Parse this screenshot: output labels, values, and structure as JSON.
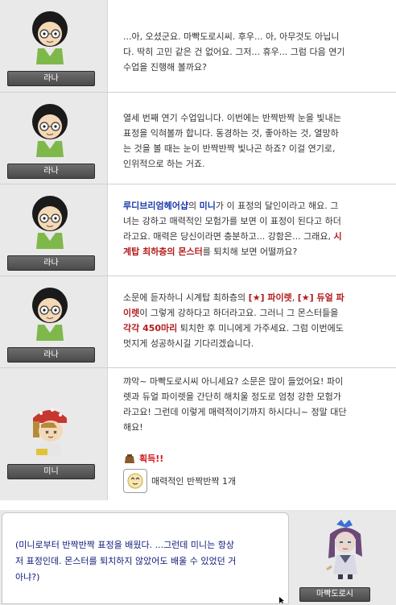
{
  "dialogs": [
    {
      "name": "라나",
      "lines": [
        "...아, 오셨군요. 마빡도로시씨. 후우... 아, 아무것도 아닙니",
        "다. 딱히 고민 같은 건 없어요. 그저... 휴우... 그럼 다음 연기",
        "수업을 진행해 볼까요?"
      ]
    },
    {
      "name": "라나",
      "lines": [
        "열세 번째 연기 수업입니다. 이번에는 반짝반짝 눈을 빛내는",
        "표정을 익혀볼까 합니다. 동경하는 것, 좋아하는 것, 열망하",
        "는 것을 볼 때는 눈이 반짝반짝 빛나곤 하죠? 이걸 연기로,",
        "인위적으로 하는 거죠."
      ]
    },
    {
      "name": "라나",
      "segments": [
        {
          "t": "루디브리엄헤어샵",
          "c": "blue"
        },
        {
          "t": "의 ",
          "c": ""
        },
        {
          "t": "미니",
          "c": "blue"
        },
        {
          "t": "가 이 표정의 달인이라고 해요. 그",
          "c": ""
        },
        {
          "t": "\n",
          "c": ""
        },
        {
          "t": "녀는 강하고 매력적인 모험가를 보면 이 표정이 된다고 하더",
          "c": ""
        },
        {
          "t": "\n",
          "c": ""
        },
        {
          "t": "라고요. 매력은 당신이라면 충분하고... 강함은... 그래요, ",
          "c": ""
        },
        {
          "t": "시",
          "c": "red"
        },
        {
          "t": "\n",
          "c": ""
        },
        {
          "t": "계탑 최하층의 몬스터",
          "c": "red"
        },
        {
          "t": "를 퇴치해 보면 어떨까요?",
          "c": ""
        }
      ]
    },
    {
      "name": "라나",
      "segments": [
        {
          "t": "소문에 듣자하니 시계탑 최하층의 ",
          "c": ""
        },
        {
          "t": "[★] 파이렛",
          "c": "red"
        },
        {
          "t": ", ",
          "c": ""
        },
        {
          "t": "[★] 듀얼 파",
          "c": "red"
        },
        {
          "t": "\n",
          "c": ""
        },
        {
          "t": "이렛",
          "c": "red"
        },
        {
          "t": "이 그렇게 강하다고 하더라고요. 그러니 그 몬스터들을",
          "c": ""
        },
        {
          "t": "\n",
          "c": ""
        },
        {
          "t": "각각 450마리",
          "c": "red"
        },
        {
          "t": " 퇴치한 후 미니에게 가주세요. 그럼 이번에도",
          "c": ""
        },
        {
          "t": "\n",
          "c": ""
        },
        {
          "t": "멋지게 성공하시길 기다리겠습니다.",
          "c": ""
        }
      ]
    },
    {
      "name": "미니",
      "lines": [
        "꺄악~ 마빡도로시씨 아니세요? 소문은 많이 들었어요! 파이",
        "렛과 듀얼 파이렛을 간단히 해치울 정도로 엄청 강한 모험가",
        "라고요! 그런데 이렇게 매력적이기까지 하시다니~ 정말 대단",
        "해요!"
      ]
    }
  ],
  "reward": {
    "label": "획득!!",
    "item_name": "매력적인 반짝반짝 1개"
  },
  "player": {
    "name": "마빡도로시",
    "lines": [
      "(미니로부터 반짝반짝 표정을 배웠다. ...그런데 미니는 항상",
      "저 표정인데. 몬스터를 퇴치하지 않았어도 배울 수 있었던 거",
      "아냐?)"
    ]
  },
  "colors": {
    "text": "#333333",
    "npc_highlight_blue": "#1a3aa8",
    "quest_highlight_red": "#b21d1d",
    "player_text": "#111a7a",
    "nameplate": "#555555",
    "portrait_bg": "#e9e9e9"
  }
}
